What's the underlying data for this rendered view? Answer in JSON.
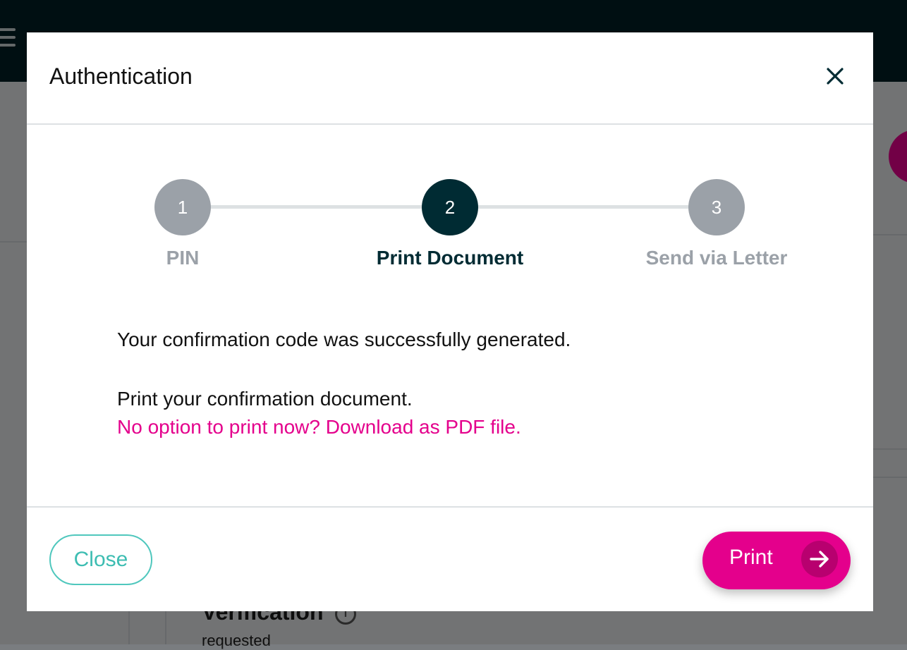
{
  "background": {
    "section_title": "Verification",
    "section_status": "requested"
  },
  "modal": {
    "title": "Authentication",
    "close_icon": "close-icon",
    "steps": [
      {
        "number": "1",
        "label": "PIN",
        "state": "done"
      },
      {
        "number": "2",
        "label": "Print Document",
        "state": "active"
      },
      {
        "number": "3",
        "label": "Send via Letter",
        "state": "pending"
      }
    ],
    "message": "Your confirmation code was successfully generated.",
    "instruction": "Print your confirmation document.",
    "pdf_link": "No option to print now? Download as PDF file.",
    "close_button": "Close",
    "print_button": "Print"
  },
  "colors": {
    "brand_pink": "#e4008c",
    "dark_teal": "#002b33",
    "teal_outline": "#4fc7bd",
    "inactive_gray": "#9ba1a8"
  }
}
